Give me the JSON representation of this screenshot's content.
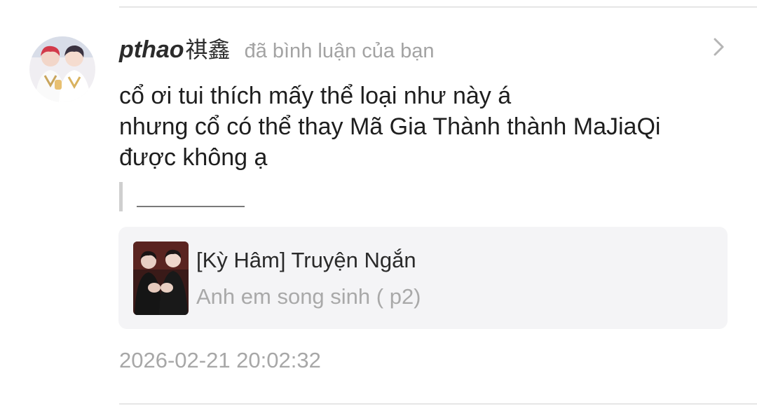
{
  "comment_notification": {
    "user": {
      "name": "pthao",
      "name_suffix": "祺鑫",
      "avatar_icon": "profile-photo-two-performers"
    },
    "action_text": "đã bình luận của bạn",
    "chevron_icon": "chevron-right-icon",
    "comment_lines": [
      "cổ ơi tui thích mấy thể loại như này á",
      "nhưng cổ có thể thay Mã Gia Thành thành MaJiaQi",
      "được không ạ"
    ],
    "quoted_text": "",
    "referenced_story": {
      "title": "[Kỳ Hâm] Truyện Ngắn",
      "chapter": "Anh em song sinh ( p2)",
      "cover_icon": "story-cover-two-people"
    },
    "timestamp": "2026-02-21 20:02:32"
  },
  "colors": {
    "background": "#ffffff",
    "card_background": "#f4f4f6",
    "primary_text": "#1e1e1e",
    "secondary_text": "#a3a3a3",
    "divider": "#e6e6e6"
  }
}
